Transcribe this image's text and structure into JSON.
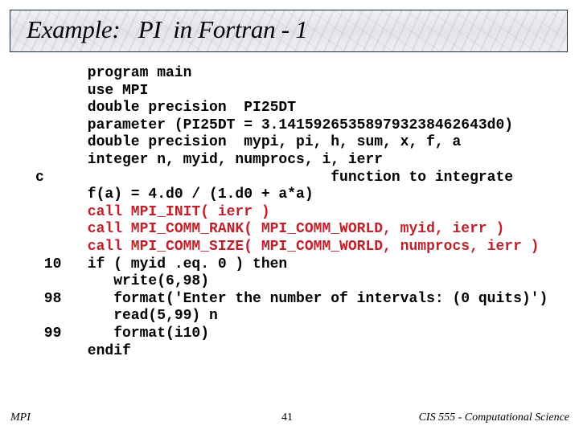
{
  "slide": {
    "title": "Example:   PI  in Fortran - 1",
    "code_lines": [
      {
        "label": "",
        "text": "program main",
        "mpi": false
      },
      {
        "label": "",
        "text": "use MPI",
        "mpi": false
      },
      {
        "label": "",
        "text": "double precision  PI25DT",
        "mpi": false
      },
      {
        "label": "",
        "text": "parameter (PI25DT = 3.141592653589793238462643d0)",
        "mpi": false
      },
      {
        "label": "",
        "text": "double precision  mypi, pi, h, sum, x, f, a",
        "mpi": false
      },
      {
        "label": "",
        "text": "integer n, myid, numprocs, i, ierr",
        "mpi": false
      },
      {
        "label": "c",
        "text": "                            function to integrate",
        "mpi": false
      },
      {
        "label": "",
        "text": "f(a) = 4.d0 / (1.d0 + a*a)",
        "mpi": false
      },
      {
        "label": "",
        "text": "call MPI_INIT( ierr )",
        "mpi": true
      },
      {
        "label": "",
        "text": "call MPI_COMM_RANK( MPI_COMM_WORLD, myid, ierr )",
        "mpi": true
      },
      {
        "label": "",
        "text": "call MPI_COMM_SIZE( MPI_COMM_WORLD, numprocs, ierr )",
        "mpi": true
      },
      {
        "label": " 10",
        "text": "if ( myid .eq. 0 ) then",
        "mpi": false
      },
      {
        "label": "",
        "text": "   write(6,98)",
        "mpi": false
      },
      {
        "label": " 98",
        "text": "   format('Enter the number of intervals: (0 quits)')",
        "mpi": false
      },
      {
        "label": "",
        "text": "   read(5,99) n",
        "mpi": false
      },
      {
        "label": " 99",
        "text": "   format(i10)",
        "mpi": false
      },
      {
        "label": "",
        "text": "endif",
        "mpi": false
      }
    ],
    "footer": {
      "left": "MPI",
      "page_number": "41",
      "right": "CIS 555 - Computational Science"
    },
    "colors": {
      "mpi_call": "#c0202a",
      "code": "#000000",
      "title_border": "#1f2f40"
    }
  }
}
